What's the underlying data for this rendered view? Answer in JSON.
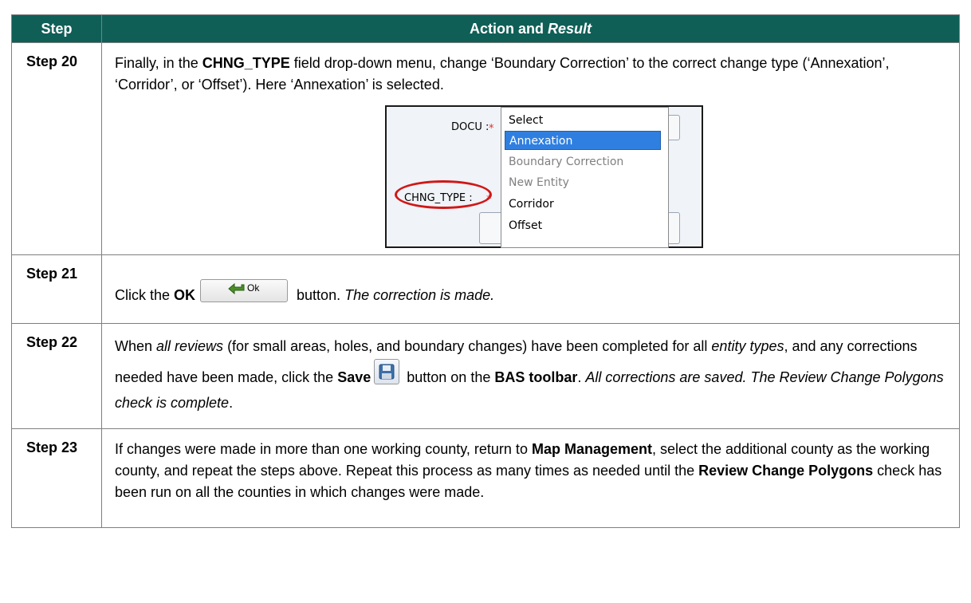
{
  "header": {
    "step": "Step",
    "action_prefix": "Action and ",
    "action_italic": "Result"
  },
  "rows": [
    {
      "step": "Step 20",
      "p1": "Finally, in the ",
      "b1": "CHNG_TYPE",
      "p2": " field drop-down menu, change ‘Boundary Correction’ to the correct change type (‘Annexation’, ‘Corridor’, or ‘Offset’). Here ‘Annexation’ is selected."
    },
    {
      "step": "Step 21",
      "p1": "Click the ",
      "b1": "OK",
      "p2": " button. ",
      "i1": "The correction is made."
    },
    {
      "step": "Step 22",
      "p1": "When ",
      "i1": "all reviews",
      "p2": " (for small areas, holes, and boundary changes) have been completed for all ",
      "i2": "entity types",
      "p3": ", and any corrections needed have been made, click the ",
      "b1": "Save",
      "p4": " button on the ",
      "b2": "BAS toolbar",
      "p5": ". ",
      "i3": "All corrections are saved. The Review Change Polygons check is complete",
      "p6": "."
    },
    {
      "step": "Step 23",
      "p1": "If changes were made in more than one working county, return to ",
      "b1": "Map Management",
      "p2": ", select the additional county as the working county, and repeat the steps above. Repeat this process as many times as needed until the ",
      "b2": "Review Change Polygons",
      "p3": " check has been run on all the counties in which changes were made."
    }
  ],
  "dropdown_shot": {
    "docu_label": "DOCU :",
    "chng_label": "CHNG_TYPE :",
    "required_mark": "*",
    "options": [
      "Select",
      "Annexation",
      "Boundary Correction",
      "New Entity",
      "Corridor",
      "Offset"
    ],
    "selected": "Annexation"
  },
  "ok_button": {
    "label": "Ok"
  },
  "colors": {
    "header_bg": "#0f5f57",
    "selected_option": "#2f7fe0",
    "highlight_oval": "#d01818"
  }
}
